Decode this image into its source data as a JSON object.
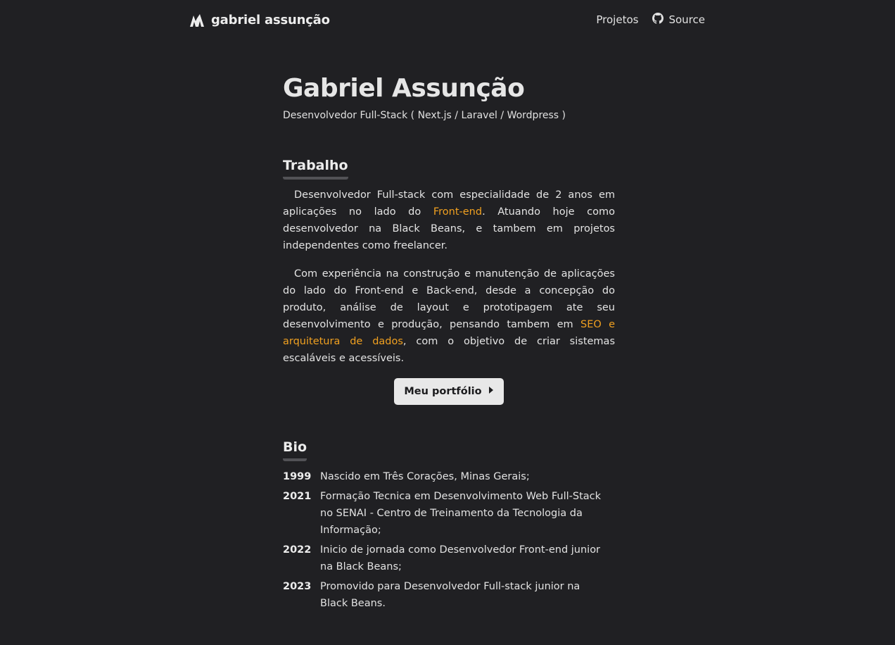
{
  "nav": {
    "brand": "gabriel assunção",
    "links": [
      {
        "label": "Projetos",
        "icon": null
      },
      {
        "label": "Source",
        "icon": "github-icon"
      }
    ]
  },
  "hero": {
    "title": "Gabriel Assunção",
    "subtitle": "Desenvolvedor Full-Stack ( Next.js / Laravel / Wordpress )"
  },
  "work": {
    "heading": "Trabalho",
    "p1": {
      "before": "Desenvolvedor Full-stack com especialidade de 2 anos em aplicações no lado do ",
      "link": "Front-end",
      "after": ". Atuando hoje como desenvolvedor na Black Beans, e tambem em projetos independentes como freelancer."
    },
    "p2": {
      "before": "Com experiência na construção e manutenção de aplicações do lado do Front-end e Back-end, desde a concepção do produto, análise de layout e prototipagem ate seu desenvolvimento e produção, pensando tambem em ",
      "link": "SEO e arquitetura de dados",
      "after": ", com o objetivo de criar sistemas escaláveis e acessíveis."
    },
    "button_label": "Meu portfólio"
  },
  "bio": {
    "heading": "Bio",
    "items": [
      {
        "year": "1999",
        "text": "Nascido em Três Corações, Minas Gerais;"
      },
      {
        "year": "2021",
        "text": "Formação Tecnica em Desenvolvimento Web Full-Stack no SENAI - Centro de Treinamento da Tecnologia da Informação;"
      },
      {
        "year": "2022",
        "text": "Inicio de jornada como Desenvolvedor Front-end junior na Black Beans;"
      },
      {
        "year": "2023",
        "text": "Promovido para Desenvolvedor Full-stack junior na Black Beans."
      }
    ]
  },
  "colors": {
    "background": "#202023",
    "accent": "#f0a020",
    "button_bg": "#e8e8e8"
  }
}
